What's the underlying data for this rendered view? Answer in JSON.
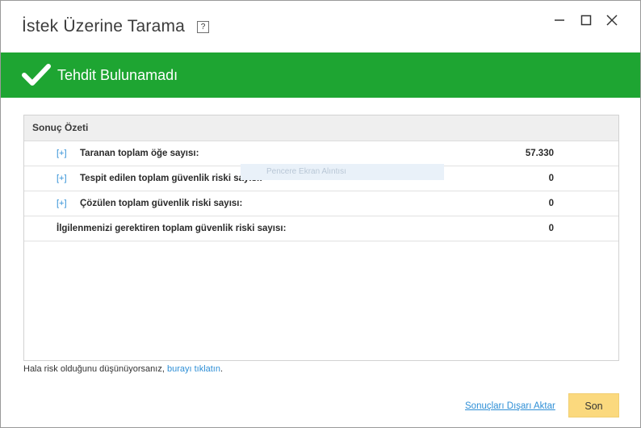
{
  "window": {
    "title": "İstek Üzerine Tarama",
    "help_label": "?"
  },
  "banner": {
    "status_text": "Tehdit Bulunamadı",
    "color": "#1ea532",
    "icon": "check-icon"
  },
  "summary": {
    "header": "Sonuç Özeti",
    "expand_label": "[+]",
    "rows": [
      {
        "label": "Taranan toplam öğe sayısı:",
        "value": "57.330",
        "expandable": true
      },
      {
        "label": "Tespit edilen toplam güvenlik riski sayısı:",
        "value": "0",
        "expandable": true
      },
      {
        "label": "Çözülen toplam güvenlik riski sayısı:",
        "value": "0",
        "expandable": true
      },
      {
        "label": "İlgilenmenizi gerektiren toplam güvenlik riski sayısı:",
        "value": "0",
        "expandable": false
      }
    ],
    "ghost_tooltip": "Pencere Ekran Alıntısı"
  },
  "footer": {
    "risk_prefix": "Hala risk olduğunu düşünüyorsanız, ",
    "risk_link": "burayı tıklatın",
    "risk_suffix": ".",
    "export_label": "Sonuçları Dışarı Aktar",
    "finish_label": "Son"
  },
  "colors": {
    "accent_link": "#2f8fd6",
    "finish_button": "#fbd97e"
  }
}
